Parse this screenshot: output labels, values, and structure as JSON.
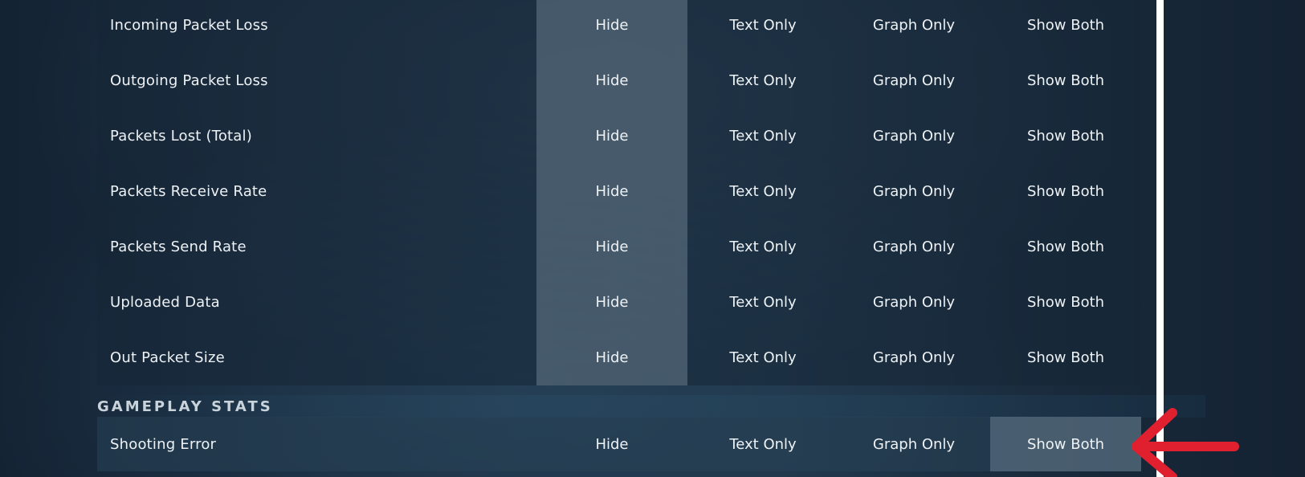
{
  "options": [
    "Hide",
    "Text Only",
    "Graph Only",
    "Show Both"
  ],
  "network_rows": [
    {
      "label": "Incoming Packet Loss",
      "selected": "Hide"
    },
    {
      "label": "Outgoing Packet Loss",
      "selected": "Hide"
    },
    {
      "label": "Packets Lost (Total)",
      "selected": "Hide"
    },
    {
      "label": "Packets Receive Rate",
      "selected": "Hide"
    },
    {
      "label": "Packets Send Rate",
      "selected": "Hide"
    },
    {
      "label": "Uploaded Data",
      "selected": "Hide"
    },
    {
      "label": "Out Packet Size",
      "selected": "Hide"
    }
  ],
  "gameplay_section": {
    "title": "GAMEPLAY STATS",
    "rows": [
      {
        "label": "Shooting Error",
        "selected": "Show Both"
      }
    ]
  },
  "annotation": {
    "icon": "red-arrow-left",
    "color": "#e0202f"
  }
}
